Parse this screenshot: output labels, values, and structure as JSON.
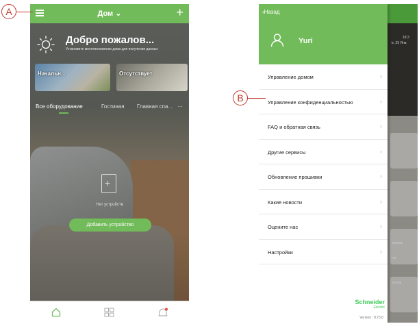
{
  "callouts": {
    "a": "A",
    "b": "B"
  },
  "left_screen": {
    "header": {
      "title": "Дом ⌄",
      "plus": "+"
    },
    "welcome": {
      "title": "Добро пожалов...",
      "subtitle": "Установите местоположение дома для получения данных"
    },
    "scenes": [
      {
        "label": "Начальн..."
      },
      {
        "label": "Отсутствует"
      }
    ],
    "tabs": [
      {
        "label": "Все оборудование",
        "active": true
      },
      {
        "label": "Гостиная",
        "active": false
      },
      {
        "label": "Главная спа...",
        "active": false
      },
      {
        "label": "···",
        "active": false
      }
    ],
    "empty_state": {
      "text": "Нет устройств"
    },
    "add_button": {
      "label": "Добавить устройство"
    },
    "bottom_nav": [
      {
        "icon": "home-icon"
      },
      {
        "icon": "grid-icon"
      },
      {
        "icon": "bell-icon"
      }
    ]
  },
  "right_screen": {
    "drawer": {
      "back_label": "Назад",
      "user_name": "Yuri",
      "menu": [
        {
          "label": "Управление домом"
        },
        {
          "label": "Управление конфиденциальностью"
        },
        {
          "label": "FAQ и обратная связь"
        },
        {
          "label": "Другие сервисы"
        },
        {
          "label": "Обновление прошивки"
        },
        {
          "label": "Какие новости"
        },
        {
          "label": "Оцените нас"
        },
        {
          "label": "Настройки"
        }
      ],
      "logo": {
        "line1": "Schneider",
        "line2": "Electric"
      },
      "version": "Version : 8.73.0"
    },
    "background_peek": {
      "time": "18:3",
      "date": "tr, 25 Янв",
      "labels": [
        "...",
        "ельное",
        "нег",
        "ютное"
      ]
    }
  },
  "colors": {
    "accent_green": "#72bb5a",
    "callout_red": "#c0392b",
    "logo_green": "#3dcd58"
  }
}
